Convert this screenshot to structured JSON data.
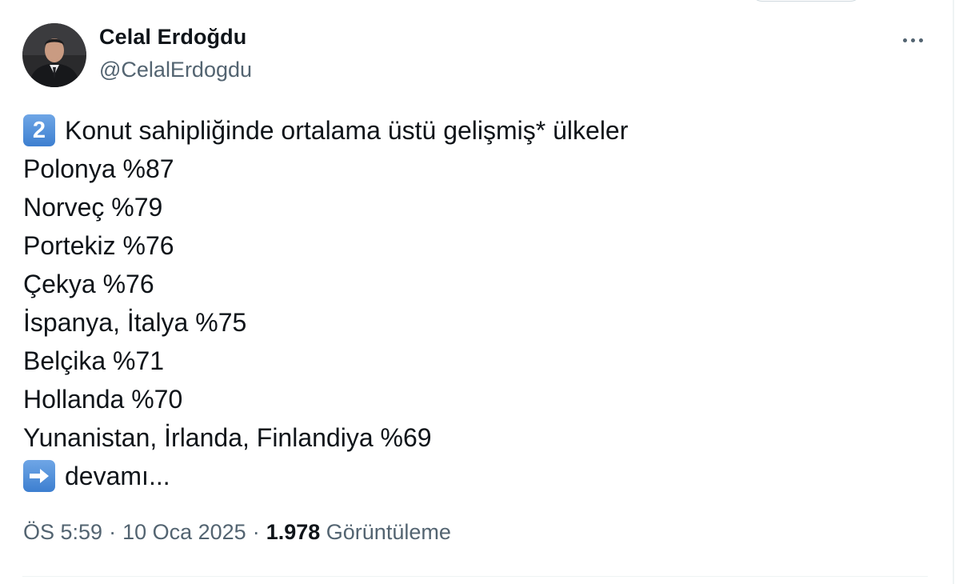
{
  "author": {
    "display_name": "Celal Erdoğdu",
    "handle": "@CelalErdogdu"
  },
  "tweet": {
    "heading_emoji": "2",
    "heading_text": "Konut sahipliğinde ortalama üstü gelişmiş* ülkeler",
    "lines": [
      "Polonya %87",
      "Norveç %79",
      "Portekiz %76",
      "Çekya %76",
      "İspanya, İtalya %75",
      "Belçika %71",
      "Hollanda %70",
      "Yunanistan, İrlanda, Finlandiya %69"
    ],
    "footer_text": "devamı..."
  },
  "meta": {
    "time": "ÖS 5:59",
    "date": "10 Oca 2025",
    "views_count": "1.978",
    "views_label": "Görüntüleme"
  },
  "icons": {
    "more": "more-horizontal-icon",
    "keycap": "keycap-digit-two-icon",
    "arrow": "right-arrow-emoji-icon"
  },
  "colors": {
    "text_primary": "#0f1419",
    "text_secondary": "#536471",
    "emoji_blue": "#4a8ad8",
    "divider": "#eff3f4"
  }
}
